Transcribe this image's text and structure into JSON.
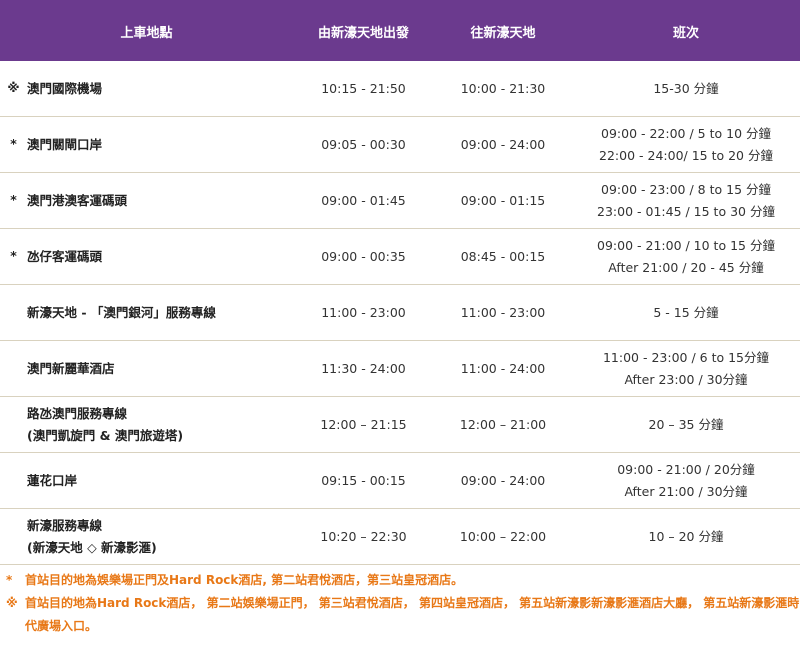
{
  "headers": [
    "上車地點",
    "由新濠天地出發",
    "往新濠天地",
    "班次"
  ],
  "rows": [
    {
      "marker": "※",
      "location": [
        "澳門國際機場"
      ],
      "from": "10:15 - 21:50",
      "to": "10:00 - 21:30",
      "freq": [
        "15-30 分鐘"
      ]
    },
    {
      "marker": "*",
      "location": [
        "澳門關閘口岸"
      ],
      "from": "09:05 - 00:30",
      "to": "09:00 - 24:00",
      "freq": [
        "09:00 - 22:00 / 5 to 10 分鐘",
        "22:00 - 24:00/ 15 to 20 分鐘"
      ]
    },
    {
      "marker": "*",
      "location": [
        "澳門港澳客運碼頭"
      ],
      "from": "09:00 - 01:45",
      "to": "09:00 - 01:15",
      "freq": [
        "09:00 - 23:00 / 8 to 15 分鐘",
        "23:00 - 01:45 / 15 to 30 分鐘"
      ]
    },
    {
      "marker": "*",
      "location": [
        "氹仔客運碼頭"
      ],
      "from": "09:00 - 00:35",
      "to": "08:45 - 00:15",
      "freq": [
        "09:00 - 21:00 / 10 to 15 分鐘",
        "After 21:00 / 20 - 45 分鐘"
      ]
    },
    {
      "marker": "",
      "location": [
        "新濠天地 - 「澳門銀河」服務專線"
      ],
      "from": "11:00 - 23:00",
      "to": "11:00 - 23:00",
      "freq": [
        "5 - 15 分鐘"
      ]
    },
    {
      "marker": "",
      "location": [
        "澳門新麗華酒店"
      ],
      "from": "11:30 - 24:00",
      "to": "11:00 - 24:00",
      "freq": [
        "11:00 - 23:00 / 6 to 15分鐘",
        "After 23:00 / 30分鐘"
      ]
    },
    {
      "marker": "",
      "location": [
        "路氹澳門服務專線",
        "(澳門凱旋門 & 澳門旅遊塔)"
      ],
      "from": "12:00 – 21:15",
      "to": "12:00 – 21:00",
      "freq": [
        "20 – 35 分鐘"
      ]
    },
    {
      "marker": "",
      "location": [
        "蓮花口岸"
      ],
      "from": "09:15 - 00:15",
      "to": "09:00 - 24:00",
      "freq": [
        "09:00 - 21:00 / 20分鐘",
        "After 21:00 / 30分鐘"
      ]
    },
    {
      "marker": "",
      "location": [
        "新濠服務專線",
        "(新濠天地 ◇ 新濠影滙)"
      ],
      "from": "10:20 – 22:30",
      "to": "10:00 – 22:00",
      "freq": [
        "10 – 20 分鐘"
      ]
    }
  ],
  "notes": [
    {
      "marker": "*",
      "text": "首站目的地為娛樂場正門及Hard Rock酒店, 第二站君悅酒店，第三站皇冠酒店。"
    },
    {
      "marker": "※",
      "text": "首站目的地為Hard Rock酒店， 第二站娛樂場正門， 第三站君悅酒店， 第四站皇冠酒店， 第五站新濠影新濠影滙酒店大廳， 第五站新濠影滙時代廣場入口。"
    }
  ],
  "colors": {
    "header_bg": "#6b3a8e",
    "header_text": "#ffffff",
    "note_text": "#e87817",
    "row_border": "#d9d2bf"
  }
}
